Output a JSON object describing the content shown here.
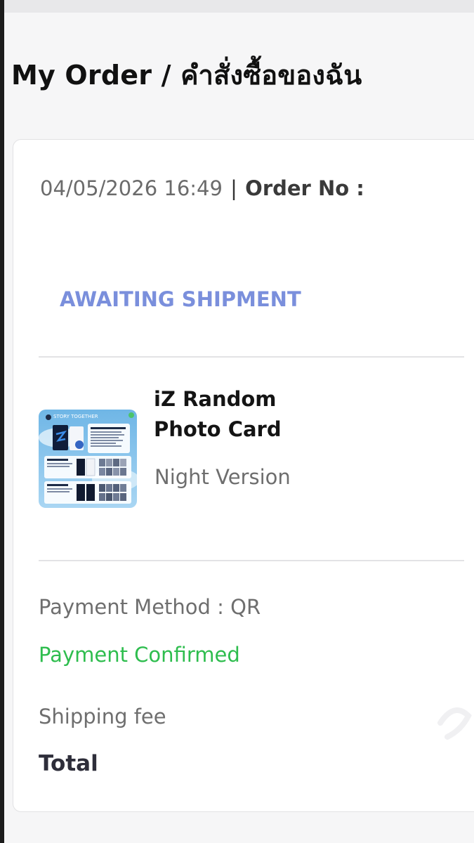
{
  "page": {
    "title": "My Order / คำสั่งซื้อของฉัน"
  },
  "order": {
    "date_time": "04/05/2026 16:49",
    "separator": "|",
    "order_no_label": "Order No :",
    "status": "AWAITING SHIPMENT",
    "item": {
      "name": "iZ Random Photo Card",
      "variant": "Night Version",
      "thumbnail_texts": {
        "headline": "STORY TOGETHER"
      }
    },
    "payment_method": "Payment Method : QR",
    "payment_status": "Payment Confirmed",
    "shipping_label": "Shipping fee",
    "total_label": "Total"
  },
  "colors": {
    "status_blue": "#7a8fdc",
    "confirmed_green": "#2ebd4e",
    "title_black": "#111111"
  }
}
